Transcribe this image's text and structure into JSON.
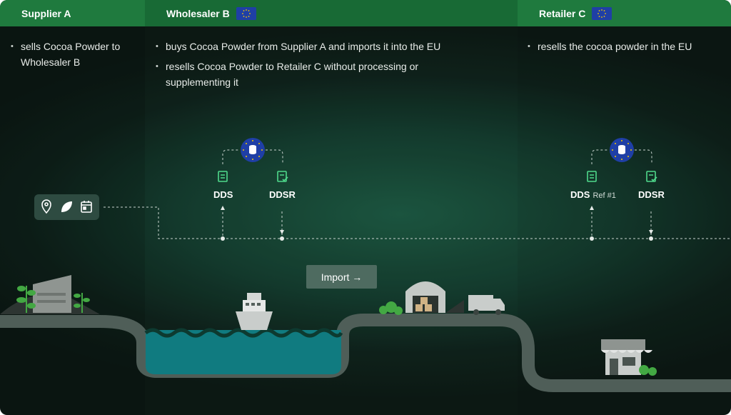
{
  "columns": [
    {
      "title": "Supplier A",
      "has_eu_flag": false,
      "bullets": [
        "sells Cocoa Powder to Wholesaler B"
      ]
    },
    {
      "title": "Wholesaler B",
      "has_eu_flag": true,
      "bullets": [
        "buys Cocoa Powder from Supplier A and imports it into the EU",
        "resells Cocoa Powder to Retailer C without processing or supplementing it"
      ]
    },
    {
      "title": "Retailer C",
      "has_eu_flag": true,
      "bullets": [
        "resells the cocoa powder in the EU"
      ]
    }
  ],
  "wholesaler_docs": {
    "dds": "DDS",
    "ddsr": "DDSR"
  },
  "retailer_docs": {
    "dds": "DDS",
    "dds_ref": "Ref #1",
    "ddsr": "DDSR"
  },
  "import_button": "Import →",
  "icons": [
    "location-pin-icon",
    "leaf-icon",
    "calendar-icon",
    "eu-database-icon",
    "document-icon",
    "document-check-icon",
    "eu-flag-icon",
    "ship-icon",
    "warehouse-icon",
    "truck-icon",
    "store-icon",
    "factory-icon",
    "plant-icon"
  ],
  "colors": {
    "header_green": "#1f7a3e",
    "eu_blue": "#1f3fa6",
    "eu_stars": "#f5c800",
    "doc_icon": "#4fd98b",
    "water": "#107b80",
    "road": "#4f5e58",
    "plant": "#43a843"
  }
}
